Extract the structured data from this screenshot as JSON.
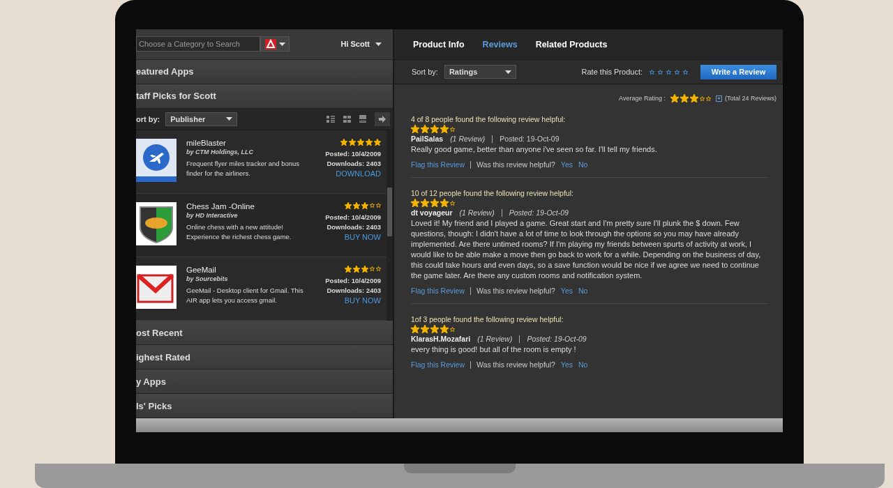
{
  "left_panel": {
    "search": {
      "placeholder": "Choose a Category to Search"
    },
    "user_menu": {
      "label": "Hi Scott"
    },
    "sections_top": [
      {
        "label": "eatured Apps"
      },
      {
        "label": "taff Picks for Scott"
      }
    ],
    "sort": {
      "label": "ort by:",
      "value": "Publisher"
    },
    "apps": [
      {
        "name": "mileBlaster",
        "publisher": "by CTM Holdings, LLC",
        "description": "Frequent flyer miles tracker and bonus finder for the airliners.",
        "stars": 5,
        "posted": "Posted: 10/4/2009",
        "downloads": "Downloads: 2403",
        "action": "DOWNLOAD"
      },
      {
        "name": "Chess Jam -Online",
        "publisher": "by HD Interactive",
        "description": "Online chess with a new attitude! Experience the richest chess game.",
        "stars": 3,
        "posted": "Posted: 10/4/2009",
        "downloads": "Downloads: 2403",
        "action": "BUY NOW"
      },
      {
        "name": "GeeMail",
        "publisher": "by Sourcebits",
        "description": "GeeMail - Desktop client for Gmail. This AIR app lets you access gmail.",
        "stars": 3,
        "posted": "Posted: 10/4/2009",
        "downloads": "Downloads: 2403",
        "action": "BUY NOW"
      }
    ],
    "sections_bottom": [
      {
        "label": "ost Recent"
      },
      {
        "label": "ighest Rated"
      },
      {
        "label": "y Apps"
      },
      {
        "label": "ls' Picks"
      }
    ]
  },
  "right_panel": {
    "tabs": [
      {
        "label": "Product Info",
        "selected": false
      },
      {
        "label": "Reviews",
        "selected": true
      },
      {
        "label": "Related Products",
        "selected": false
      }
    ],
    "sort": {
      "label": "Sort by:",
      "value": "Ratings"
    },
    "rate": {
      "label": "Rate this Product:",
      "stars": 0
    },
    "write_button": "Write a Review",
    "average": {
      "label": "Average Rating :",
      "stars": 3,
      "total": "(Total 24 Reviews)"
    },
    "reviews": [
      {
        "helpful": "4 of 8 people found the following review helpful:",
        "stars": 4,
        "author": "PailSalas",
        "count": "(1 Review)",
        "posted": "Posted: 19-Oct-09",
        "text": "Really good game, better than anyone i've seen so far. I'll tell my friends.",
        "flag": "Flag this Review",
        "question": "Was this review helpful?",
        "yes": "Yes",
        "no": "No"
      },
      {
        "helpful": "10 of 12 people found the following review helpful:",
        "stars": 4,
        "author": "dt voyageur",
        "count": "(1 Review)",
        "posted": "Posted: 19-Oct-09",
        "text": "Loved it! My friend and I played a game. Great start and I'm pretty sure I'll plunk the $ down. Few questions, though: I didn't have a lot of time to look through the options so you may have already implemented. Are there untimed rooms? If I'm playing my friends between spurts of activity at work, I would like to be able make a move then go back to work for a while. Depending on the business of day, this could take hours and even days, so a save function would be nice if we agree we need to continue the game later. Are there any custom rooms and notification system.",
        "flag": "Flag this Review",
        "question": "Was this review helpful?",
        "yes": "Yes",
        "no": "No"
      },
      {
        "helpful": "1of 3 people found the following review helpful:",
        "stars": 4,
        "author": "KlarasH.Mozafari",
        "count": "(1 Review)",
        "posted": "Posted: 19-Oct-09",
        "text": "every thing is good! but all of the room is empty !",
        "flag": "Flag this Review",
        "question": "Was this review helpful?",
        "yes": "Yes",
        "no": "No"
      }
    ]
  }
}
